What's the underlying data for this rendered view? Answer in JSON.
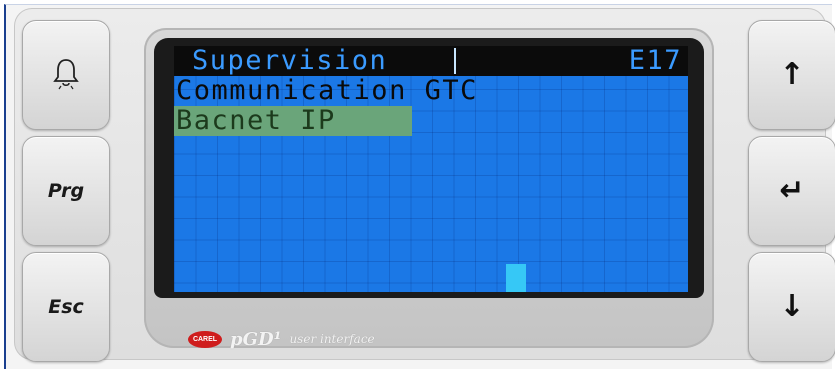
{
  "left_buttons": {
    "alarm_icon": "bell-icon",
    "prg_label": "Prg",
    "esc_label": "Esc"
  },
  "right_buttons": {
    "up": "↑",
    "enter": "↵",
    "down": "↓"
  },
  "display": {
    "title": "Supervision",
    "screen_code": "E17",
    "line2": "Communication GTC",
    "line3_selected": "Bacnet IP"
  },
  "branding": {
    "logo_text": "CAREL",
    "product": "pGD¹",
    "subtitle": "user interface"
  },
  "colors": {
    "lcd_background": "#1b78e6",
    "title_bar": "#0b0b0b",
    "selection_highlight": "#6aa57a",
    "brand_logo": "#cf1d1d"
  }
}
